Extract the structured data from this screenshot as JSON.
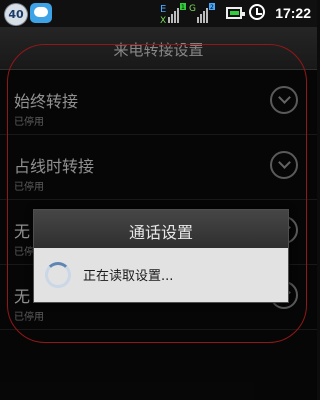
{
  "status_bar": {
    "notification_badge": "40",
    "network_type": "E",
    "signal_labels": [
      "X",
      "1",
      "G",
      "2"
    ],
    "time": "17:22",
    "icons": [
      "badge-icon",
      "chat-icon",
      "signal-icon",
      "battery-icon",
      "alarm-icon"
    ]
  },
  "header": {
    "title": "来电转接设置"
  },
  "items": [
    {
      "title": "始终转接",
      "subtitle": "已停用"
    },
    {
      "title": "占线时转接",
      "subtitle": "已停用"
    },
    {
      "title": "无",
      "subtitle": "已停用"
    },
    {
      "title": "无",
      "subtitle": "已停用"
    }
  ],
  "dialog": {
    "title": "通话设置",
    "message": "正在读取设置..."
  },
  "colors": {
    "annotation": "#e12424",
    "battery": "#2fce3a",
    "dialog_body": "#e2e2e2"
  }
}
